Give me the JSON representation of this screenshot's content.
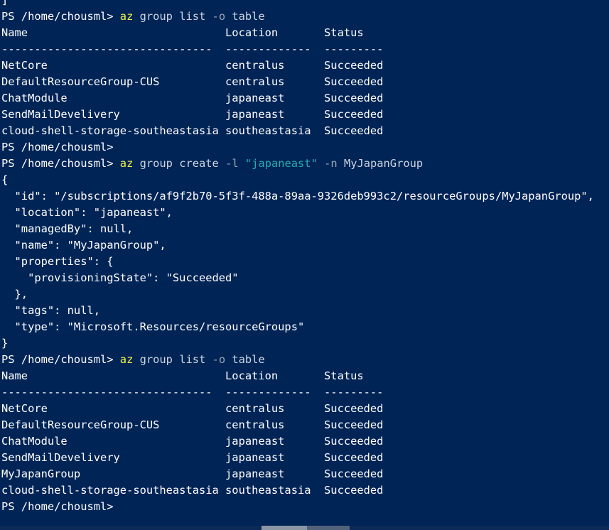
{
  "terminal": {
    "colors": {
      "background": "#012456",
      "text": "#ffffff",
      "command": "#f5f543",
      "string": "#23aeb3",
      "flag": "#9aa6b4"
    },
    "lines": [
      [
        {
          "t": "]",
          "c": "prompt"
        }
      ],
      [
        {
          "t": "PS /home/chousml> ",
          "c": "prompt"
        },
        {
          "t": "az",
          "c": "cmd"
        },
        {
          "t": " group list ",
          "c": "arg"
        },
        {
          "t": "-o",
          "c": "flag"
        },
        {
          "t": " table",
          "c": "arg"
        }
      ],
      [
        {
          "t": "Name                              Location       Status",
          "c": "prompt"
        }
      ],
      [
        {
          "t": "--------------------------------  -------------  ---------",
          "c": "prompt"
        }
      ],
      [
        {
          "t": "NetCore                           centralus      Succeeded",
          "c": "prompt"
        }
      ],
      [
        {
          "t": "DefaultResourceGroup-CUS          centralus      Succeeded",
          "c": "prompt"
        }
      ],
      [
        {
          "t": "ChatModule                        japaneast      Succeeded",
          "c": "prompt"
        }
      ],
      [
        {
          "t": "SendMailDevelivery                japaneast      Succeeded",
          "c": "prompt"
        }
      ],
      [
        {
          "t": "cloud-shell-storage-southeastasia southeastasia  Succeeded",
          "c": "prompt"
        }
      ],
      [
        {
          "t": "PS /home/chousml>",
          "c": "prompt"
        }
      ],
      [
        {
          "t": "PS /home/chousml> ",
          "c": "prompt"
        },
        {
          "t": "az",
          "c": "cmd"
        },
        {
          "t": " group create ",
          "c": "arg"
        },
        {
          "t": "-l",
          "c": "flag"
        },
        {
          "t": " ",
          "c": "arg"
        },
        {
          "t": "\"japaneast\"",
          "c": "str"
        },
        {
          "t": " ",
          "c": "arg"
        },
        {
          "t": "-n",
          "c": "flag"
        },
        {
          "t": " MyJapanGroup",
          "c": "arg"
        }
      ],
      [
        {
          "t": "{",
          "c": "prompt"
        }
      ],
      [
        {
          "t": "  \"id\": \"/subscriptions/af9f2b70-5f3f-488a-89aa-9326deb993c2/resourceGroups/MyJapanGroup\",",
          "c": "prompt"
        }
      ],
      [
        {
          "t": "  \"location\": \"japaneast\",",
          "c": "prompt"
        }
      ],
      [
        {
          "t": "  \"managedBy\": null,",
          "c": "prompt"
        }
      ],
      [
        {
          "t": "  \"name\": \"MyJapanGroup\",",
          "c": "prompt"
        }
      ],
      [
        {
          "t": "  \"properties\": {",
          "c": "prompt"
        }
      ],
      [
        {
          "t": "    \"provisioningState\": \"Succeeded\"",
          "c": "prompt"
        }
      ],
      [
        {
          "t": "  },",
          "c": "prompt"
        }
      ],
      [
        {
          "t": "  \"tags\": null,",
          "c": "prompt"
        }
      ],
      [
        {
          "t": "  \"type\": \"Microsoft.Resources/resourceGroups\"",
          "c": "prompt"
        }
      ],
      [
        {
          "t": "}",
          "c": "prompt"
        }
      ],
      [
        {
          "t": "PS /home/chousml> ",
          "c": "prompt"
        },
        {
          "t": "az",
          "c": "cmd"
        },
        {
          "t": " group list ",
          "c": "arg"
        },
        {
          "t": "-o",
          "c": "flag"
        },
        {
          "t": " table",
          "c": "arg"
        }
      ],
      [
        {
          "t": "Name                              Location       Status",
          "c": "prompt"
        }
      ],
      [
        {
          "t": "--------------------------------  -------------  ---------",
          "c": "prompt"
        }
      ],
      [
        {
          "t": "NetCore                           centralus      Succeeded",
          "c": "prompt"
        }
      ],
      [
        {
          "t": "DefaultResourceGroup-CUS          centralus      Succeeded",
          "c": "prompt"
        }
      ],
      [
        {
          "t": "ChatModule                        japaneast      Succeeded",
          "c": "prompt"
        }
      ],
      [
        {
          "t": "SendMailDevelivery                japaneast      Succeeded",
          "c": "prompt"
        }
      ],
      [
        {
          "t": "MyJapanGroup                      japaneast      Succeeded",
          "c": "prompt"
        }
      ],
      [
        {
          "t": "cloud-shell-storage-southeastasia southeastasia  Succeeded",
          "c": "prompt"
        }
      ],
      [
        {
          "t": "PS /home/chousml>",
          "c": "prompt"
        }
      ]
    ]
  }
}
